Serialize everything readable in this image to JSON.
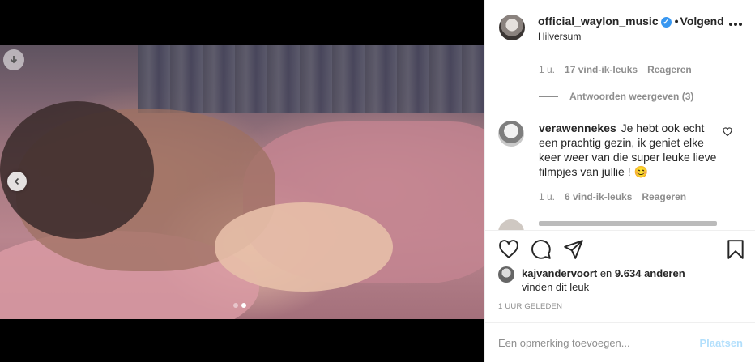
{
  "post": {
    "username": "official_waylon_music",
    "separator": "•",
    "follow_label": "Volgend",
    "location": "Hilversum",
    "verified_icon": "verified-badge-icon"
  },
  "carousel": {
    "slides": 2,
    "active_slide": 2
  },
  "comments": {
    "prev_meta": {
      "time": "1 u.",
      "likes": "17 vind-ik-leuks",
      "reply": "Reageren"
    },
    "view_replies": "Antwoorden weergeven (3)",
    "items": [
      {
        "username": "verawennekes",
        "text": "Je hebt ook echt een prachtig gezin, ik geniet elke keer weer van die super leuke lieve filmpjes van jullie ! 😊",
        "time": "1 u.",
        "likes": "6 vind-ik-leuks",
        "reply": "Reageren"
      }
    ]
  },
  "likes": {
    "user": "kajvandervoort",
    "joiner": "en",
    "others": "9.634 anderen",
    "suffix": "vinden dit leuk"
  },
  "timestamp": "1 UUR GELEDEN",
  "comment_box": {
    "placeholder": "Een opmerking toevoegen...",
    "post_label": "Plaatsen"
  },
  "colors": {
    "accent": "#3897f0",
    "text": "#262626",
    "muted": "#8e8e8e",
    "post_disabled": "#b2dffc"
  }
}
